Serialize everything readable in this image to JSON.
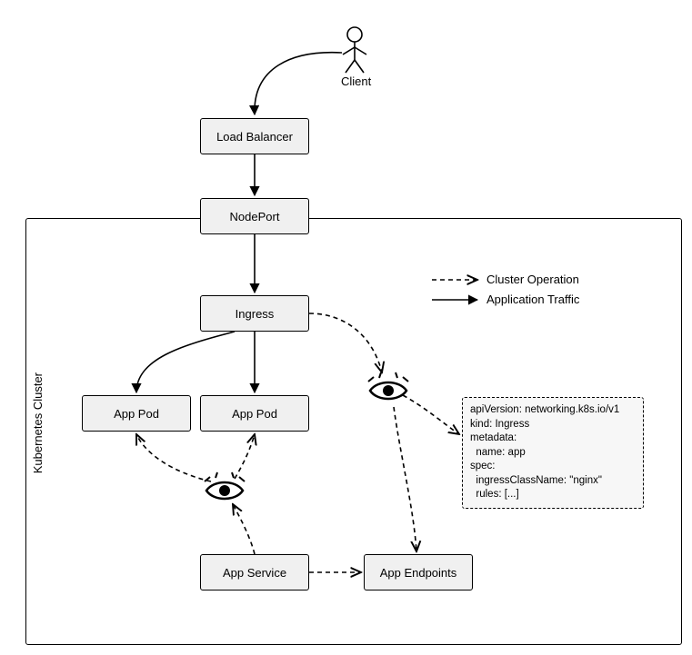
{
  "actor": {
    "label": "Client"
  },
  "boxes": {
    "loadBalancer": "Load Balancer",
    "nodePort": "NodePort",
    "ingress": "Ingress",
    "appPod1": "App Pod",
    "appPod2": "App Pod",
    "appService": "App Service",
    "appEndpoints": "App Endpoints"
  },
  "cluster": {
    "label": "Kubernetes Cluster"
  },
  "legend": {
    "clusterOp": "Cluster Operation",
    "appTraffic": "Application Traffic"
  },
  "spec": "apiVersion: networking.k8s.io/v1\nkind: Ingress\nmetadata:\n  name: app\nspec:\n  ingressClassName: \"nginx\"\n  rules: [...]"
}
